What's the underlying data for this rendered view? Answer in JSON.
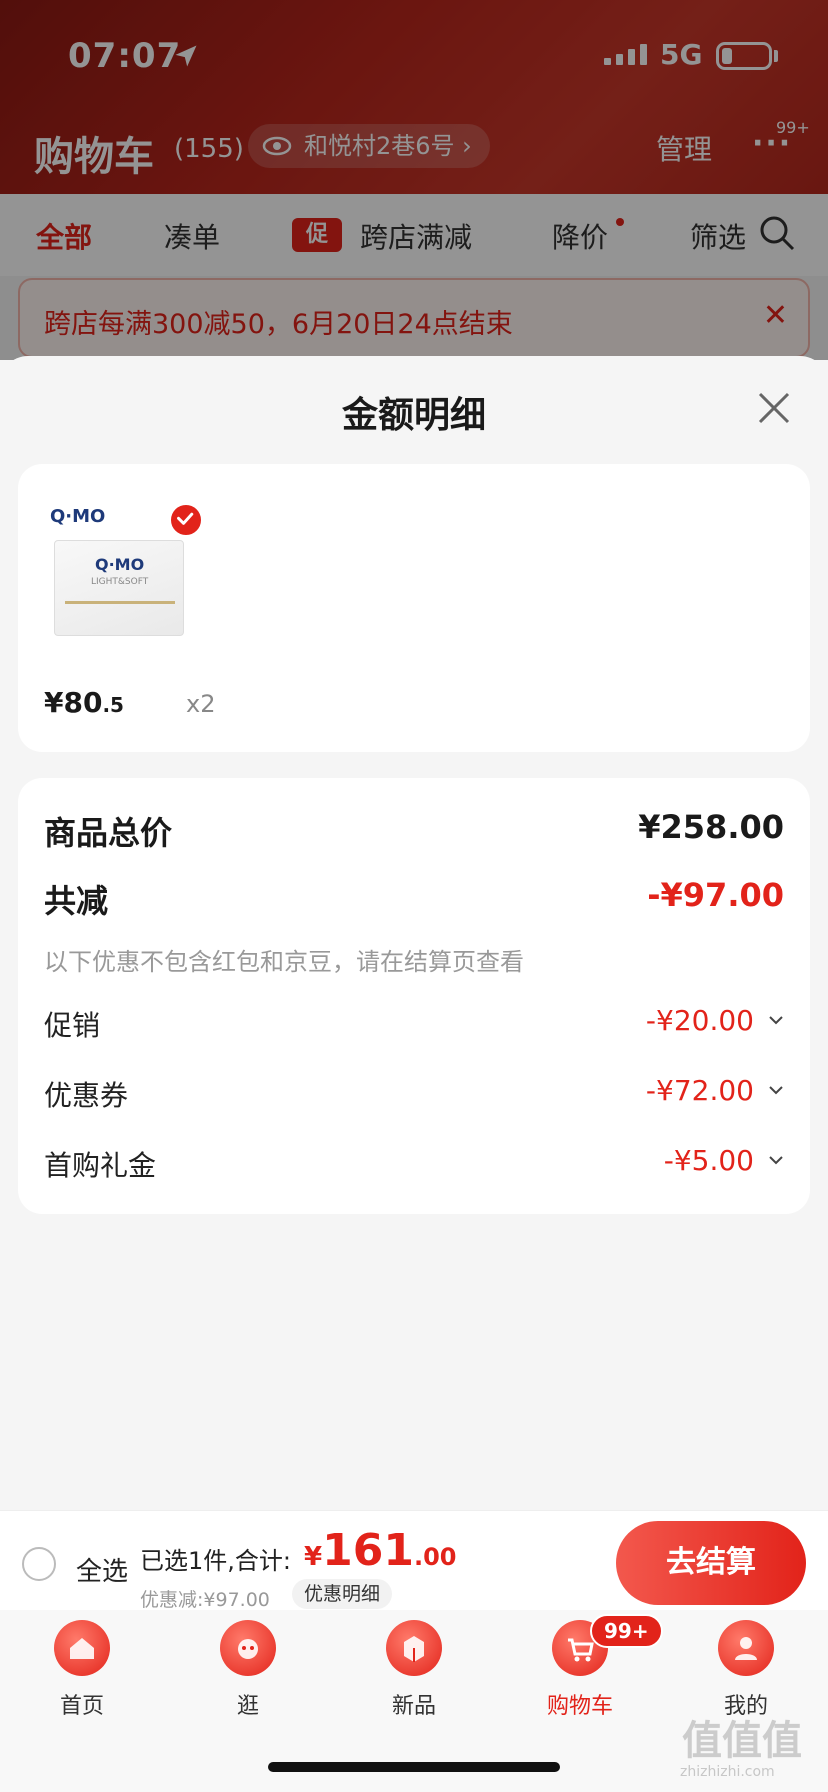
{
  "status_bar": {
    "time": "07:07",
    "network": "5G"
  },
  "header": {
    "title": "购物车",
    "count": "(155)",
    "address": "和悦村2巷6号 ›",
    "manage_label": "管理",
    "more_label": "···",
    "message_badge": "99+"
  },
  "filters": [
    {
      "label": "全部"
    },
    {
      "label": "凑单"
    },
    {
      "label": "跨店满减",
      "tag": "促"
    },
    {
      "label": "降价"
    },
    {
      "label": "筛选"
    }
  ],
  "promo_banner": {
    "text": "跨店每满300减50，6月20日24点结束",
    "close": "✕"
  },
  "sheet": {
    "title": "金额明细",
    "product": {
      "brand": "Q·MO",
      "box_brand": "Q·MO",
      "box_subtitle": "LIGHT&SOFT",
      "price_int": "¥80",
      "price_dec": ".5",
      "quantity": "x2"
    },
    "summary": {
      "total_label": "商品总价",
      "total_value": "¥258.00",
      "reduce_label": "共减",
      "reduce_value": "-¥97.00",
      "note": "以下优惠不包含红包和京豆，请在结算页查看",
      "items": [
        {
          "label": "促销",
          "value": "-¥20.00"
        },
        {
          "label": "优惠券",
          "value": "-¥72.00"
        },
        {
          "label": "首购礼金",
          "value": "-¥5.00"
        }
      ]
    }
  },
  "checkout": {
    "select_all": "全选",
    "selected_text": "已选1件,合计:",
    "currency": "¥",
    "total_int": "161",
    "total_dec": ".00",
    "discount_text": "优惠减:¥97.00",
    "detail_label": "优惠明细",
    "button_label": "去结算"
  },
  "tabbar": [
    {
      "label": "首页",
      "icon": "home-icon"
    },
    {
      "label": "逛",
      "icon": "browse-icon"
    },
    {
      "label": "新品",
      "icon": "new-products-icon"
    },
    {
      "label": "购物车",
      "icon": "cart-icon",
      "badge": "99+"
    },
    {
      "label": "我的",
      "icon": "profile-icon"
    }
  ],
  "watermark": {
    "text": "值值值",
    "url": "zhizhizhi.com"
  },
  "colors": {
    "accent": "#e2231a",
    "header_bg": "#b8261c",
    "sheet_bg": "#f5f5f5"
  }
}
